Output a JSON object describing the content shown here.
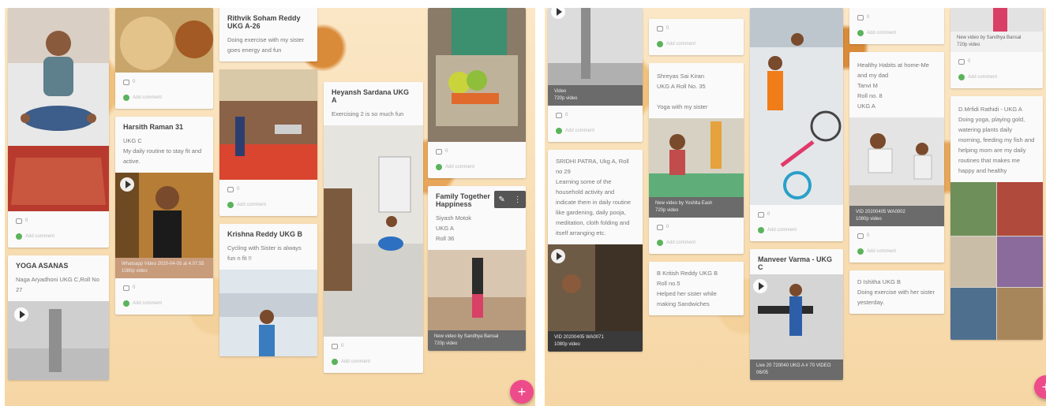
{
  "left": {
    "col1": {
      "card_like_count": "0",
      "card_add_comment": "Add comment",
      "yoga_title": "YOGA ASANAS",
      "yoga_body": "Naga Aryadhoni UKG C,Roll No 27"
    },
    "col2": {
      "like_count": "0",
      "add_comment": "Add comment",
      "title": "Harsith Raman 31",
      "body": "UKG C\nMy daily routine to stay fit and active.",
      "video_caption": "Whatsapp Video 2020-04-05 at 4.07.55",
      "video_sub": "1080p video",
      "like_count2": "0",
      "add_comment2": "Add comment"
    },
    "col3": {
      "title": "Rithvik Soham Reddy UKG A-26",
      "body": "Doing exercise with my sister goes energy and fun",
      "like_count": "0",
      "add_comment": "Add comment",
      "card2_title": "Krishna Reddy UKG B",
      "card2_body": "Cycling with Sister is always fun n fit !!"
    },
    "col4": {
      "title": "Heyansh Sardana UKG A",
      "body": "Exercising 2 is so much fun",
      "like_count": "0",
      "add_comment": "Add comment"
    },
    "col5": {
      "like_count": "0",
      "add_comment": "Add comment",
      "title": "Family Together Happiness",
      "body": "Siyash Motok\nUKG A\nRoll 36",
      "video_caption": "New video by Sandhya Bansal",
      "video_sub": "720p video"
    }
  },
  "right": {
    "col1": {
      "video_caption": "Video",
      "video_sub": "720p video",
      "like_count": "0",
      "add_comment": "Add comment",
      "body": "SRIDHI PATRA, Ukg A, Roll no 29\nLearning some of the household activity and indicate them in daily routine like gardening, daily pooja, meditation, cloth folding and itself arranging etc.",
      "video2_caption": "VID 20200405 WA0071",
      "video2_sub": "1080p video"
    },
    "col2": {
      "like_count": "0",
      "add_comment": "Add comment",
      "body": "Shreyas Sai Kiran\nUKG A Roll No. 35\n\nYoga with my sister",
      "video_caption": "New video by Yoshita Eash",
      "video_sub": "720p video",
      "like_count2": "0",
      "add_comment2": "Add comment",
      "card3_body": "B Kritish Reddy UKG B\nRoll no.5\nHelped her sister while making Sandwiches"
    },
    "col3": {
      "like_count": "0",
      "add_comment": "Add comment",
      "title": "Manveer Varma - UKG C",
      "video_caption": "Live 20 720040 UKG A # 70 VIDEO 06/05"
    },
    "col4": {
      "like_count": "0",
      "add_comment": "Add comment",
      "body": "Healthy Habits at home-Me and my dad\nTanvi M\nRoll no. 8\nUKG A",
      "video_caption": "VID 20200405 WA0002",
      "video_sub": "1080p video",
      "like_count2": "0",
      "add_comment2": "Add comment",
      "card3_body": "D Ishitha UKG B\nDoing exercise with her sister yesterday."
    },
    "col5": {
      "video_caption": "New video by Sandhya Bansal",
      "video_sub": "720p video",
      "like_count": "0",
      "add_comment": "Add comment",
      "body": "D.Mrfidi Rathidi - UKG A\nDoing yoga, playing gold, watering plants daily morning, feeding my fish and helping mom are my daily routines that makes me happy and healthy"
    }
  },
  "fab_label": "+",
  "colors": {
    "accent": "#ee4b8a",
    "avatar": "#5bb35b",
    "card": "#fafafa"
  }
}
